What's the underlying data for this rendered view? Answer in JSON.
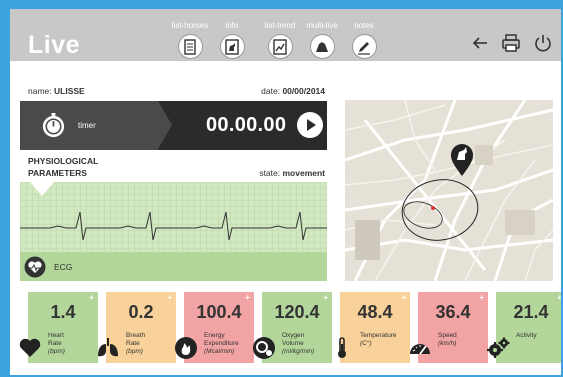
{
  "header": {
    "title": "Live",
    "nav": [
      {
        "label": "list-horses",
        "icon": "list-document-icon"
      },
      {
        "label": "info",
        "icon": "horse-info-icon"
      },
      {
        "label": "list-trend",
        "icon": "trend-chart-icon"
      },
      {
        "label": "multi-live",
        "icon": "multi-horse-icon"
      },
      {
        "label": "notes",
        "icon": "pencil-icon"
      }
    ],
    "actions": [
      "back-arrow-icon",
      "printer-icon",
      "power-icon"
    ]
  },
  "session": {
    "name_label": "name:",
    "name_value": "ULISSE",
    "date_label": "date:",
    "date_value": "00/00/2014"
  },
  "timer": {
    "label": "timer",
    "value": "00.00.00"
  },
  "physiological": {
    "title": "PHYSIOLOGICAL\nPARAMETERS",
    "state_label": "state:",
    "state_value": "movement",
    "ecg_label": "ECG"
  },
  "metrics": [
    {
      "value": "1.4",
      "label": "Heart\nRate",
      "unit": "(bpm)",
      "color": "#b3d79a",
      "icon": "heart-icon"
    },
    {
      "value": "0.2",
      "label": "Breath\nRate",
      "unit": "(bpm)",
      "color": "#f8d29a",
      "icon": "lungs-icon"
    },
    {
      "value": "100.4",
      "label": "Energy\nExpenditure",
      "unit": "(Mcal/min)",
      "color": "#f2a3a3",
      "icon": "flame-icon"
    },
    {
      "value": "120.4",
      "label": "Oxygen\nVolume",
      "unit": "(ml/kg/min)",
      "color": "#b3d79a",
      "icon": "oxygen-icon"
    },
    {
      "value": "48.4",
      "label": "Temperature",
      "unit": "(C°)",
      "color": "#f8d29a",
      "icon": "thermometer-icon"
    },
    {
      "value": "36.4",
      "label": "Speed",
      "unit": "(km/h)",
      "color": "#f2a3a3",
      "icon": "speedometer-icon"
    },
    {
      "value": "21.4",
      "label": "Activity",
      "unit": "",
      "color": "#b3d79a",
      "icon": "gears-icon"
    }
  ],
  "colors": {
    "background": "#3aa3e0",
    "header": "#c8c8c8",
    "green": "#b3d79a",
    "orange": "#f8d29a",
    "red": "#f2a3a3",
    "dark": "#2b2b2b"
  }
}
